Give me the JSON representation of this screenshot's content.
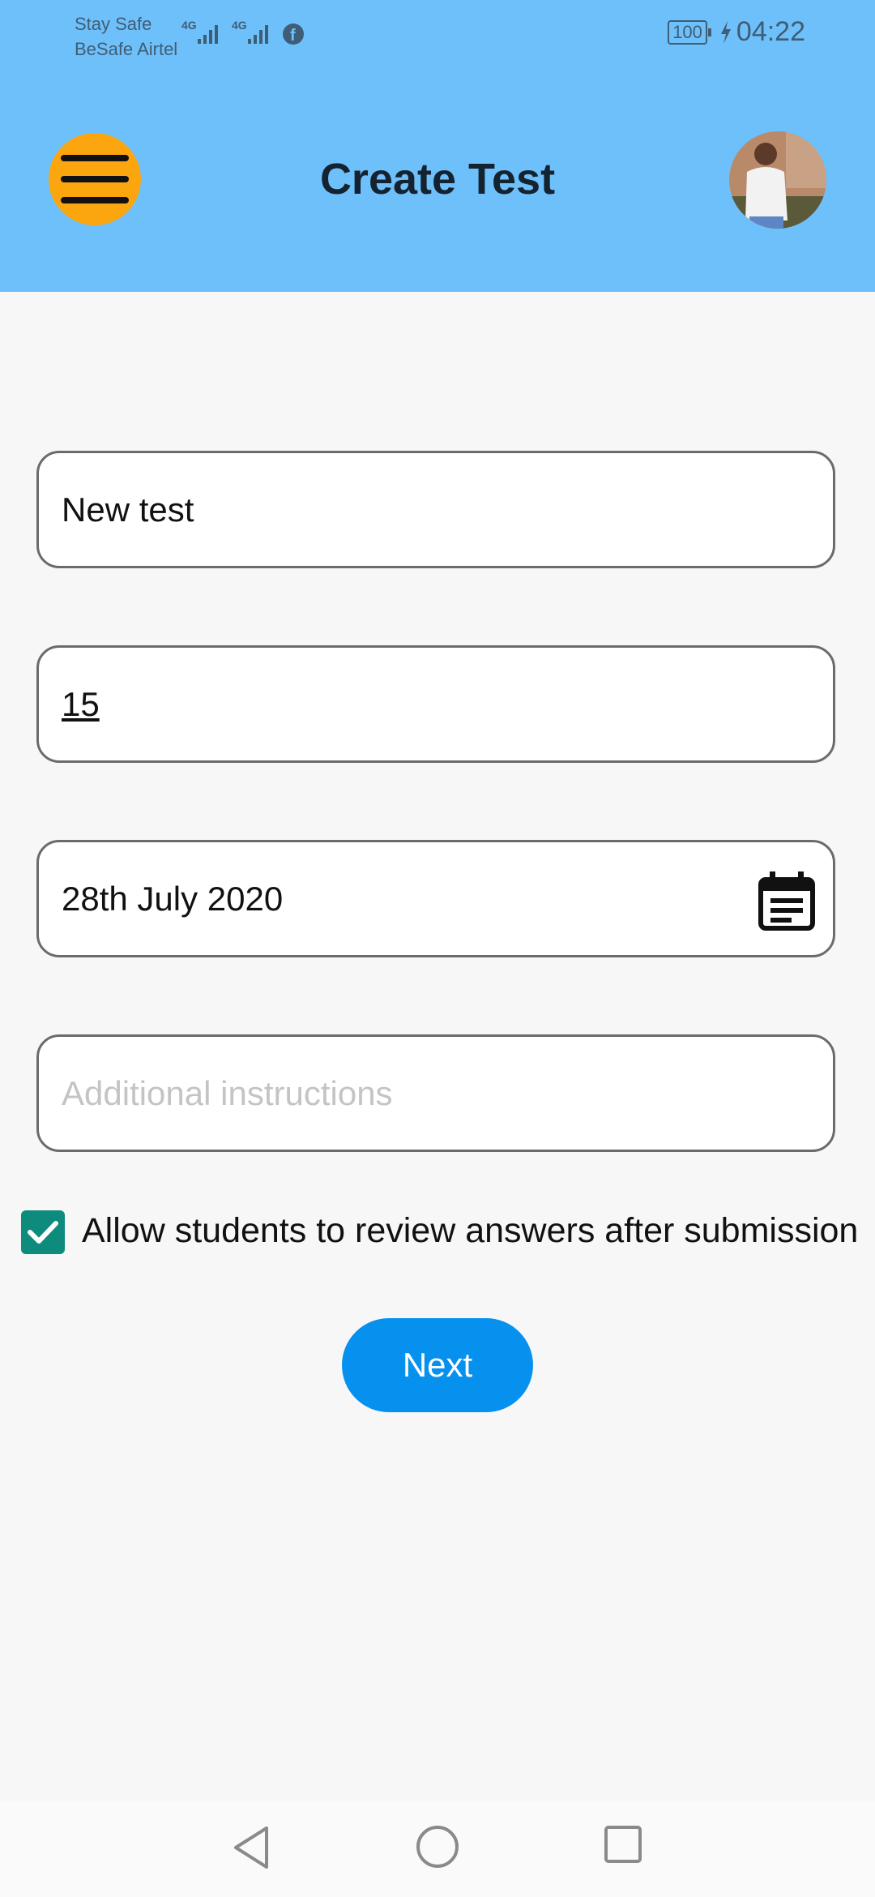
{
  "status_bar": {
    "carrier_line1": "Stay Safe",
    "carrier_line2": "BeSafe Airtel",
    "network1": "4G",
    "network2": "4G",
    "battery": "100",
    "time": "04:22"
  },
  "header": {
    "title": "Create Test",
    "menu_icon": "hamburger-menu-icon",
    "avatar_icon": "user-avatar"
  },
  "form": {
    "test_name": {
      "value": "New test",
      "placeholder": ""
    },
    "duration": {
      "value": "15",
      "placeholder": ""
    },
    "date": {
      "value": "28th July 2020",
      "placeholder": ""
    },
    "instructions": {
      "value": "",
      "placeholder": "Additional instructions"
    },
    "review_checkbox": {
      "label": "Allow students to review answers after submission",
      "checked": true
    }
  },
  "actions": {
    "next_label": "Next"
  },
  "colors": {
    "header_bg": "#6ec0fb",
    "menu_button": "#fca60f",
    "checkbox": "#0d8b7c",
    "next_button": "#0791ef"
  }
}
